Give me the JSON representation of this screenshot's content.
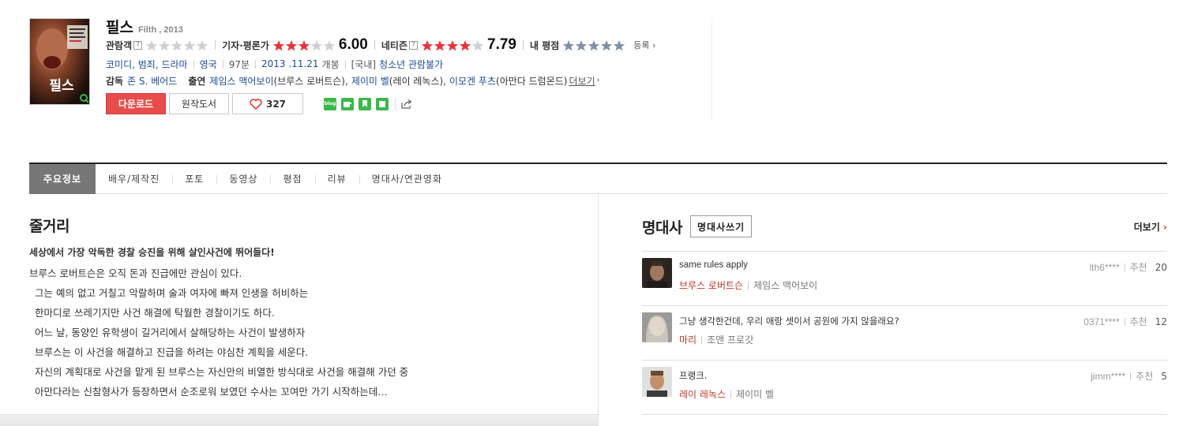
{
  "movie": {
    "title": "필스",
    "original_title": "Filth , 2013",
    "poster_text": "필스",
    "ratings": {
      "audience_label": "관람객",
      "audience_stars": 0,
      "critic_label": "기자·평론가",
      "critic_stars": 3,
      "critic_score": "6.00",
      "netizen_label": "네티즌",
      "netizen_stars": 4,
      "netizen_score": "7.79",
      "my_label": "내 평점",
      "register_label": "등록"
    },
    "genres": "코미디, 범죄, 드라마",
    "country": "영국",
    "runtime": "97분",
    "release": "2013 .11.21",
    "release_suffix": "개봉",
    "rating_prefix": "[국내]",
    "rating_grade": "청소년 관람불가",
    "director_label": "감독",
    "director": "존 S. 베어드",
    "cast_label": "출연",
    "cast": [
      {
        "name": "제임스 맥어보이",
        "role": "(브루스 로버트슨),"
      },
      {
        "name": "제이미 벨",
        "role": "(레이 레녹스),"
      },
      {
        "name": "이모겐 푸츠",
        "role": "(아만다 드럼몬드)"
      }
    ],
    "more_label": "더보기",
    "buttons": {
      "download": "다운로드",
      "book": "원작도서",
      "like_count": "327"
    }
  },
  "tabs": [
    "주요정보",
    "배우/제작진",
    "포토",
    "동영상",
    "평점",
    "리뷰",
    "명대사/연관영화"
  ],
  "synopsis": {
    "heading": "줄거리",
    "tagline": "세상에서 가장 악독한 경찰 승진을 위해 살인사건에 뛰어들다!",
    "lines": [
      "브루스 로버트슨은 오직 돈과 진급에만 관심이 있다.",
      "그는 예의 없고 거칠고 악랄하며 술과 여자에 빠져 인생을 허비하는",
      "한마디로 쓰레기지만 사건 해결에 탁월한 경찰이기도 하다.",
      "어느 날, 동양인 유학생이 길거리에서 살해당하는 사건이 발생하자",
      "브루스는 이 사건을 해결하고 진급을 하려는 야심찬 계획을 세운다.",
      "자신의 계획대로 사건을 맡게 된 브루스는 자신만의 비열한 방식대로 사건을 해결해 가던 중",
      "아만다라는 신참형사가 등장하면서 순조로워 보였던 수사는 꼬여만 가기 시작하는데…"
    ]
  },
  "quotes_section": {
    "heading": "명대사",
    "write_button": "명대사쓰기",
    "more_label": "더보기",
    "recommend_label": "추천",
    "items": [
      {
        "text": "same rules apply",
        "role": "브루스 로버트슨",
        "actor": "제임스 맥어보이",
        "user": "lth6****",
        "count": "20"
      },
      {
        "text": "그냥 생각한건데, 우리 애랑 셋이서 공원에 가지 않을래요?",
        "role": "마리",
        "actor": "조앤 프로갓",
        "user": "0371****",
        "count": "12"
      },
      {
        "text": "프랭크.",
        "role": "레이 레녹스",
        "actor": "제이미 벨",
        "user": "jimm****",
        "count": "5"
      }
    ]
  },
  "colors": {
    "accent_red": "#e84d4d",
    "star_red": "#e8323c",
    "star_gray": "#cfcfcf",
    "star_blue": "#7f8fa6",
    "link_blue": "#1a4d9c",
    "role_red": "#c0392b"
  }
}
